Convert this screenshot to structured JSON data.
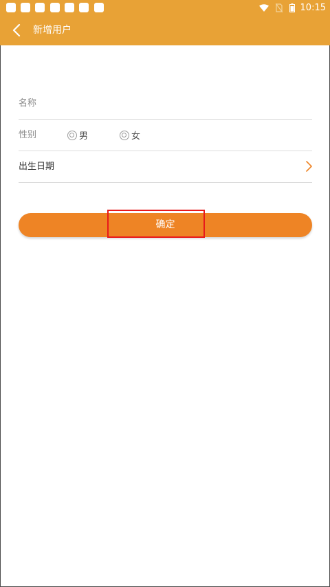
{
  "status_bar": {
    "time": "10:15",
    "notification_icons": [
      "notification-icon",
      "notification-icon",
      "notification-icon",
      "notification-icon",
      "notification-icon",
      "notification-icon",
      "notification-icon"
    ],
    "icons": [
      "wifi-icon",
      "no-sim-icon",
      "battery-icon"
    ]
  },
  "header": {
    "title": "新增用户",
    "back_icon": "chevron-left-icon"
  },
  "form": {
    "name_label": "名称",
    "gender_label": "性别",
    "gender_options": [
      "男",
      "女"
    ],
    "birthdate_label": "出生日期",
    "birthdate_icon": "chevron-right-icon"
  },
  "actions": {
    "confirm_label": "确定"
  },
  "colors": {
    "header_bg": "#e8a236",
    "button_bg": "#ee8425",
    "highlight": "#e8191b"
  }
}
